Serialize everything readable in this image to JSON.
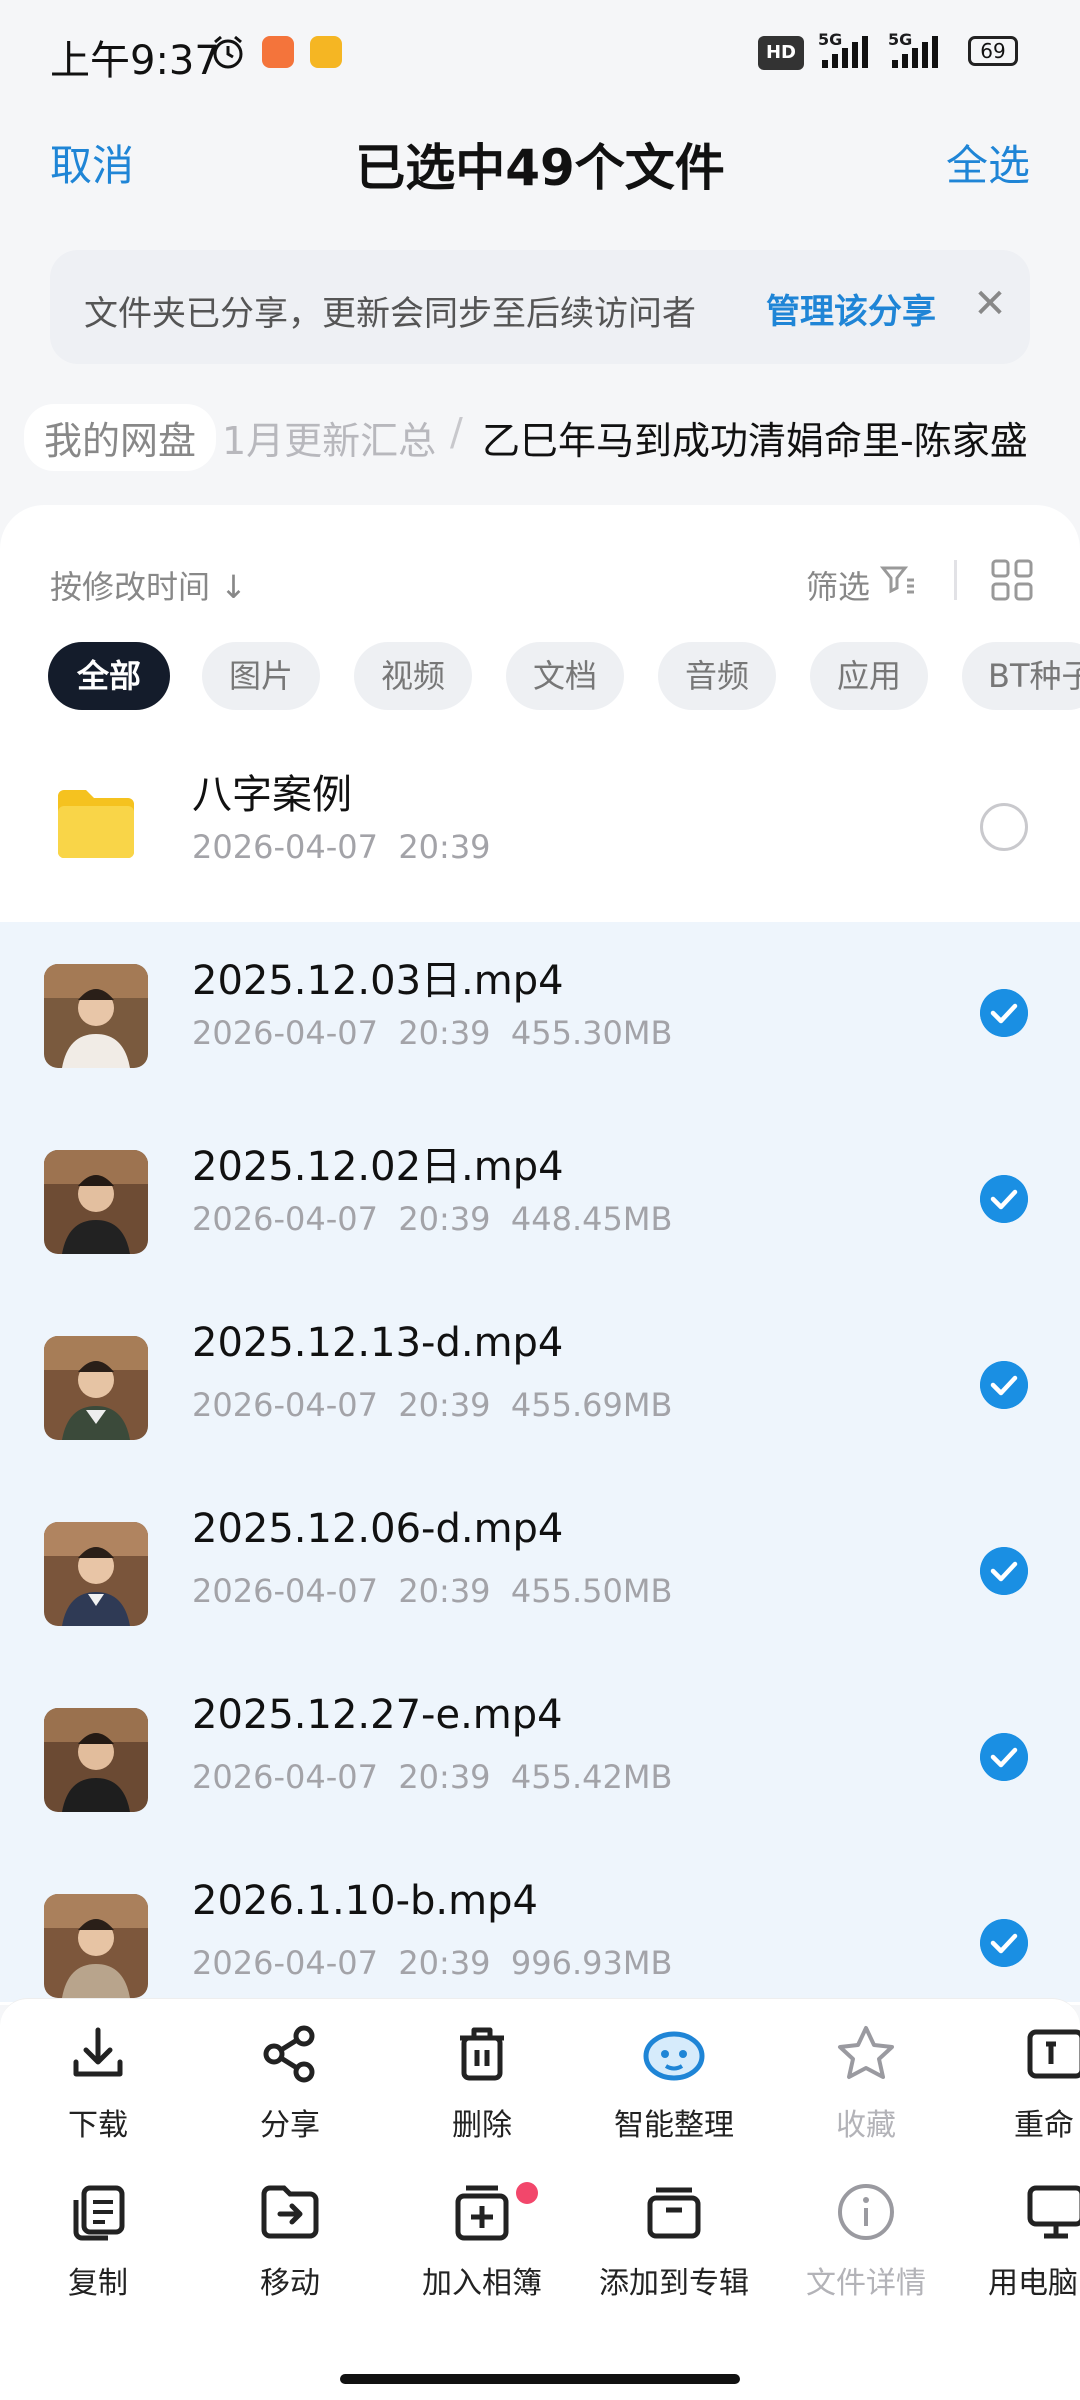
{
  "status_bar": {
    "time": "上午9:37",
    "hd_label": "HD",
    "signal1_label": "5G",
    "signal2_label": "5G",
    "battery": "69"
  },
  "header": {
    "cancel_label": "取消",
    "title": "已选中49个文件",
    "select_all_label": "全选"
  },
  "share_notice": {
    "text": "文件夹已分享，更新会同步至后续访问者",
    "manage_label": "管理该分享",
    "close_label": "✕"
  },
  "breadcrumb": {
    "root": "我的网盘",
    "middle": "1月更新汇总",
    "separator": "/",
    "current": "乙巳年马到成功清娟命里-陈家盛"
  },
  "toolbar": {
    "sort_label": "按修改时间 ↓",
    "filter_label": "筛选"
  },
  "filter_chips": [
    "全部",
    "图片",
    "视频",
    "文档",
    "音频",
    "应用",
    "BT种子"
  ],
  "folder": {
    "name": "八字案例",
    "date": "2026-04-07",
    "time": "20:39"
  },
  "files": [
    {
      "name": "2025.12.03日.mp4",
      "date": "2026-04-07",
      "time": "20:39",
      "size": "455.30MB"
    },
    {
      "name": "2025.12.02日.mp4",
      "date": "2026-04-07",
      "time": "20:39",
      "size": "448.45MB"
    },
    {
      "name": "2025.12.13-d.mp4",
      "date": "2026-04-07",
      "time": "20:39",
      "size": "455.69MB"
    },
    {
      "name": "2025.12.06-d.mp4",
      "date": "2026-04-07",
      "time": "20:39",
      "size": "455.50MB"
    },
    {
      "name": "2025.12.27-e.mp4",
      "date": "2026-04-07",
      "time": "20:39",
      "size": "455.42MB"
    },
    {
      "name": "2026.1.10-b.mp4",
      "date": "2026-04-07",
      "time": "20:39",
      "size": "996.93MB"
    }
  ],
  "actions_row1": [
    {
      "label": "下载",
      "icon": "download-icon"
    },
    {
      "label": "分享",
      "icon": "share-icon"
    },
    {
      "label": "删除",
      "icon": "trash-icon"
    },
    {
      "label": "智能整理",
      "icon": "smart-organize-icon"
    },
    {
      "label": "收藏",
      "icon": "star-icon"
    },
    {
      "label": "重命",
      "icon": "rename-icon"
    }
  ],
  "actions_row2": [
    {
      "label": "复制",
      "icon": "copy-icon"
    },
    {
      "label": "移动",
      "icon": "move-icon"
    },
    {
      "label": "加入相簿",
      "icon": "add-album-icon"
    },
    {
      "label": "添加到专辑",
      "icon": "add-collection-icon"
    },
    {
      "label": "文件详情",
      "icon": "info-icon"
    },
    {
      "label": "用电脑",
      "icon": "computer-icon"
    }
  ],
  "colors": {
    "accent": "#1f85d6",
    "check": "#1a8fe3",
    "selected_row": "#eef5fc",
    "chip_active": "#141c2b",
    "folder": "#f7c82e",
    "badge": "#f2476b"
  }
}
